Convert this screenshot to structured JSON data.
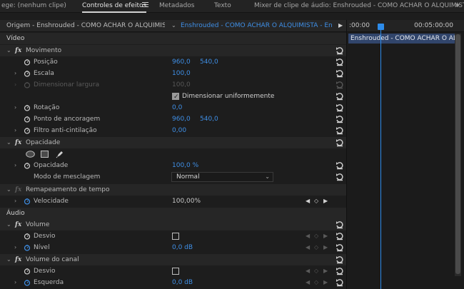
{
  "tabs": {
    "source": "ege: (nenhum clipe)",
    "effect_controls": "Controles de efeitos",
    "metadata": "Metadados",
    "text": "Texto",
    "audio_mixer": "Mixer de clipe de áudio: Enshrouded - COMO ACHAR O ALQUIMISTA"
  },
  "source_bar": {
    "origin": "Origem - Enshrouded - COMO ACHAR O ALQUIMISTA.m...",
    "sequence": "Enshrouded - COMO ACHAR O ALQUIMISTA - Enshro..."
  },
  "timeline": {
    "time_start": ":00:00",
    "time_end": "00:05:00:00",
    "clip_name": "Enshrouded - COMO ACHAR O ALQUIMISTA"
  },
  "video": {
    "section_label": "Vídeo",
    "motion": {
      "label": "Movimento",
      "position": {
        "label": "Posição",
        "x": "960,0",
        "y": "540,0"
      },
      "scale": {
        "label": "Escala",
        "value": "100,0"
      },
      "scale_width": {
        "label": "Dimensionar largura",
        "value": "100,0"
      },
      "uniform_scale": {
        "label": "Dimensionar uniformemente",
        "checked": true
      },
      "rotation": {
        "label": "Rotação",
        "value": "0,0"
      },
      "anchor": {
        "label": "Ponto de ancoragem",
        "x": "960,0",
        "y": "540,0"
      },
      "anti_flicker": {
        "label": "Filtro anti-cintilação",
        "value": "0,00"
      }
    },
    "opacity": {
      "label": "Opacidade",
      "value_label": "Opacidade",
      "value": "100,0 %",
      "blend_label": "Modo de mesclagem",
      "blend_value": "Normal"
    },
    "time_remap": {
      "label": "Remapeamento de tempo",
      "speed_label": "Velocidade",
      "speed_value": "100,00%"
    }
  },
  "audio": {
    "section_label": "Áudio",
    "volume": {
      "label": "Volume",
      "bypass_label": "Desvio",
      "level_label": "Nível",
      "level_value": "0,0 dB"
    },
    "channel_volume": {
      "label": "Volume do canal",
      "bypass_label": "Desvio",
      "left_label": "Esquerda",
      "left_value": "0,0 dB"
    }
  },
  "colors": {
    "accent_blue": "#3f8fe6",
    "clip_bar": "#31456b",
    "playhead": "#2d8ceb"
  }
}
